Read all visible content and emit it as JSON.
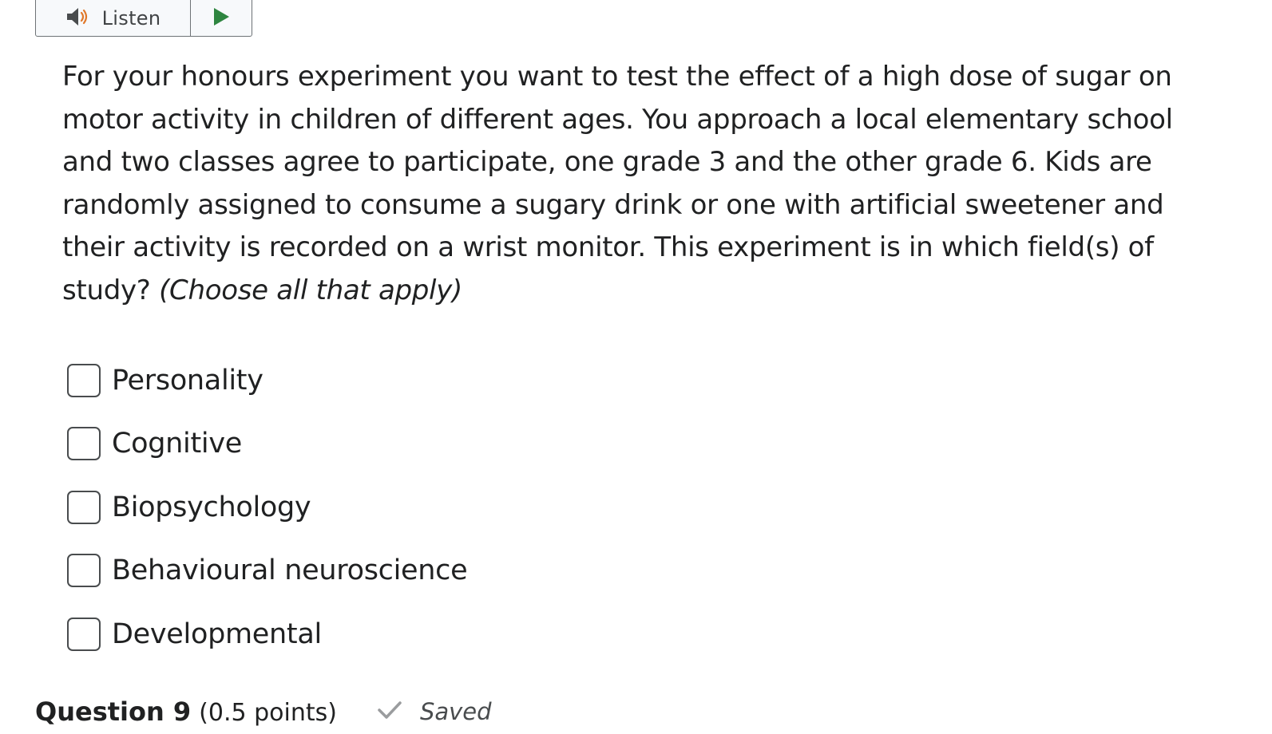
{
  "listen": {
    "label": "Listen",
    "speaker_icon": "speaker-icon",
    "play_icon": "play-icon",
    "play_color": "#2e8540"
  },
  "question": {
    "text": "For your honours experiment you want to test the effect of a high dose of sugar on motor activity in children of different ages. You approach a local elementary school and two classes agree to participate, one grade 3 and the other grade 6. Kids are randomly assigned to consume a sugary drink or one with artificial sweetener and their activity is recorded on a wrist monitor. This experiment is in which field(s) of study?",
    "instruction": "(Choose all that apply)"
  },
  "options": [
    {
      "label": "Personality",
      "checked": false
    },
    {
      "label": "Cognitive",
      "checked": false
    },
    {
      "label": "Biopsychology",
      "checked": false
    },
    {
      "label": "Behavioural neuroscience",
      "checked": false
    },
    {
      "label": "Developmental",
      "checked": false
    }
  ],
  "next_question": {
    "title": "Question 9",
    "points": "(0.5 points)",
    "status_icon": "checkmark-icon",
    "status": "Saved"
  }
}
